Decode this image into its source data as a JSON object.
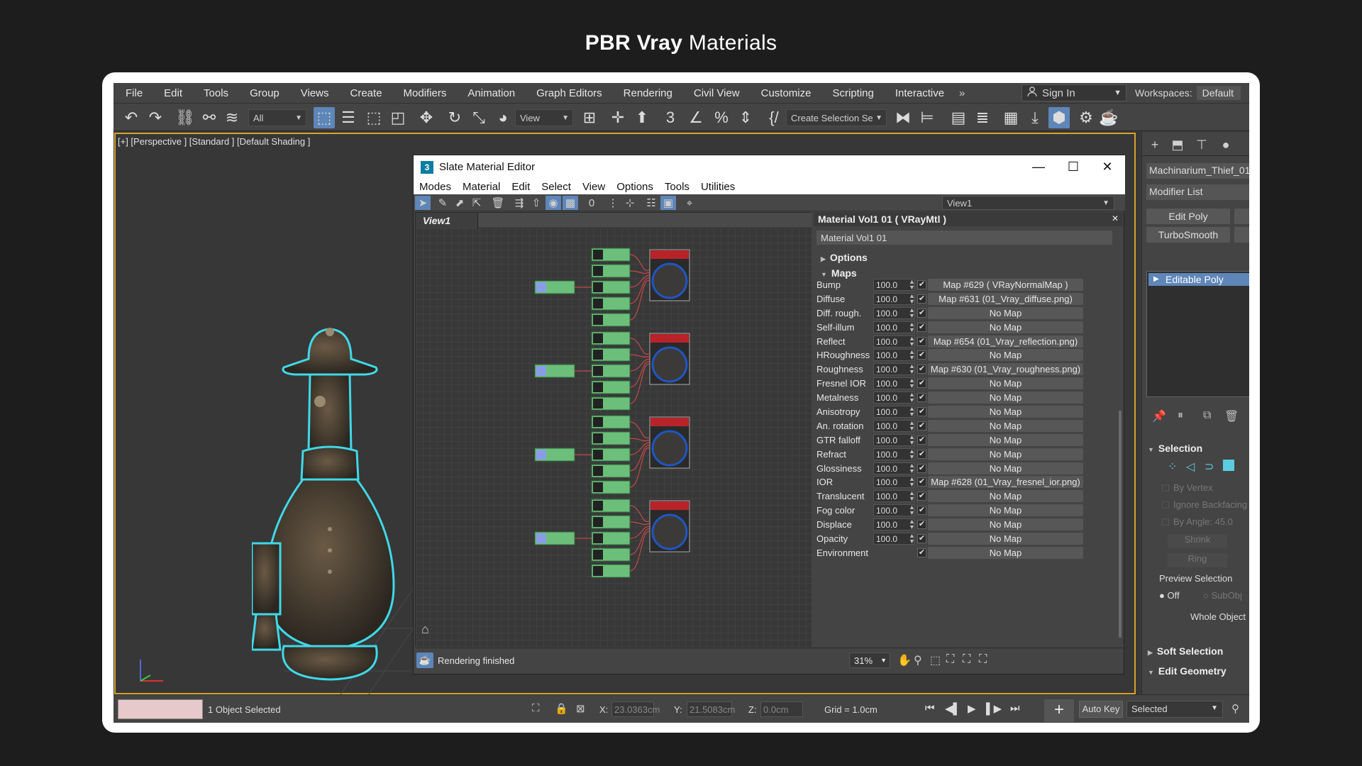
{
  "page": {
    "title_bold": "PBR Vray",
    "title_rest": "Materials"
  },
  "menu": [
    "File",
    "Edit",
    "Tools",
    "Group",
    "Views",
    "Create",
    "Modifiers",
    "Animation",
    "Graph Editors",
    "Rendering",
    "Civil View",
    "Customize",
    "Scripting",
    "Interactive"
  ],
  "menu_more": "»",
  "signin": {
    "label": "Sign In"
  },
  "workspace": {
    "label": "Workspaces:",
    "value": "Default"
  },
  "toolbar": {
    "filter_value": "All",
    "view_value": "View",
    "selection_set_placeholder": "Create Selection Se"
  },
  "viewport": {
    "label": "[+] [Perspective ] [Standard ] [Default Shading ]"
  },
  "slate": {
    "title": "Slate Material Editor",
    "logo": "3",
    "menu": [
      "Modes",
      "Material",
      "Edit",
      "Select",
      "View",
      "Options",
      "Tools",
      "Utilities"
    ],
    "view_dropdown": "View1",
    "view_tab": "View1",
    "status": "Rendering finished",
    "zoom": "31%"
  },
  "params": {
    "header": "Material Vol1 01  ( VRayMtl )",
    "name": "Material Vol1 01",
    "options_label": "Options",
    "maps_label": "Maps",
    "maps": [
      {
        "label": "Bump",
        "value": "100.0",
        "checked": true,
        "map": "Map #629  ( VRayNormalMap )"
      },
      {
        "label": "Diffuse",
        "value": "100.0",
        "checked": true,
        "map": "Map #631 (01_Vray_diffuse.png)"
      },
      {
        "label": "Diff. rough.",
        "value": "100.0",
        "checked": true,
        "map": "No Map"
      },
      {
        "label": "Self-illum",
        "value": "100.0",
        "checked": true,
        "map": "No Map"
      },
      {
        "label": "Reflect",
        "value": "100.0",
        "checked": true,
        "map": "Map #654 (01_Vray_reflection.png)"
      },
      {
        "label": "HRoughness",
        "value": "100.0",
        "checked": true,
        "map": "No Map"
      },
      {
        "label": "Roughness",
        "value": "100.0",
        "checked": true,
        "map": "Map #630 (01_Vray_roughness.png)"
      },
      {
        "label": "Fresnel IOR",
        "value": "100.0",
        "checked": true,
        "map": "No Map"
      },
      {
        "label": "Metalness",
        "value": "100.0",
        "checked": true,
        "map": "No Map"
      },
      {
        "label": "Anisotropy",
        "value": "100.0",
        "checked": true,
        "map": "No Map"
      },
      {
        "label": "An. rotation",
        "value": "100.0",
        "checked": true,
        "map": "No Map"
      },
      {
        "label": "GTR falloff",
        "value": "100.0",
        "checked": true,
        "map": "No Map"
      },
      {
        "label": "Refract",
        "value": "100.0",
        "checked": true,
        "map": "No Map"
      },
      {
        "label": "Glossiness",
        "value": "100.0",
        "checked": true,
        "map": "No Map"
      },
      {
        "label": "IOR",
        "value": "100.0",
        "checked": true,
        "map": "Map #628 (01_Vray_fresnel_ior.png)"
      },
      {
        "label": "Translucent",
        "value": "100.0",
        "checked": true,
        "map": "No Map"
      },
      {
        "label": "Fog color",
        "value": "100.0",
        "checked": true,
        "map": "No Map"
      },
      {
        "label": "Displace",
        "value": "100.0",
        "checked": true,
        "map": "No Map"
      },
      {
        "label": "Opacity",
        "value": "100.0",
        "checked": true,
        "map": "No Map"
      },
      {
        "label": "Environment",
        "value": "",
        "checked": true,
        "map": "No Map"
      }
    ]
  },
  "command_panel": {
    "object_name": "Machinarium_Thief_01",
    "modifier_list": "Modifier List",
    "edit_poly": "Edit Poly",
    "turbosmooth": "TurboSmooth",
    "stack_item": "Editable Poly",
    "selection_label": "Selection",
    "by_vertex": "By Vertex",
    "ignore_backfacing": "Ignore Backfacing",
    "by_angle": "By Angle:",
    "by_angle_value": "45.0",
    "shrink": "Shrink",
    "ring": "Ring",
    "preview_selection": "Preview Selection",
    "off": "Off",
    "subobj": "SubObj",
    "whole_object": "Whole Object",
    "soft_selection": "Soft Selection",
    "edit_geometry": "Edit Geometry"
  },
  "status": {
    "objects_selected": "1 Object Selected",
    "x_label": "X:",
    "x_value": "23.0363cm",
    "y_label": "Y:",
    "y_value": "21.5083cm",
    "z_label": "Z:",
    "z_value": "0.0cm",
    "grid": "Grid = 1.0cm",
    "auto_key": "Auto Key",
    "selected": "Selected"
  },
  "colors": {
    "accent_blue": "#5e86b8",
    "selection_cyan": "#3fd9e8",
    "viewport_border": "#d6a32a",
    "node_green": "#6bbf7a"
  }
}
